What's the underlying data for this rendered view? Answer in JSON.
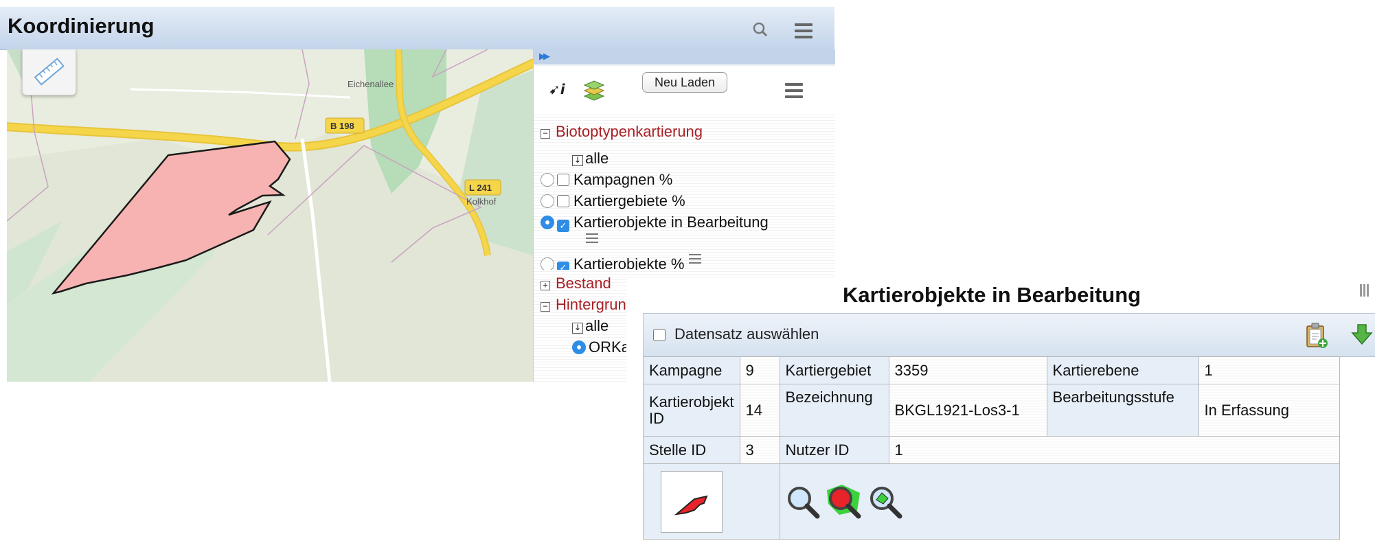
{
  "window": {
    "title": "Koordinierung"
  },
  "map": {
    "labels": {
      "street": "Eichenallee",
      "road_b": "B 198",
      "road_l": "L 241",
      "place": "Kolkhof"
    }
  },
  "panel": {
    "reload_label": "Neu Laden",
    "groups": [
      {
        "label": "Biotoptypenkartierung",
        "expanded": true,
        "all_label": "alle",
        "layers": [
          {
            "label": "Kampagnen %",
            "radio": false,
            "checked": false
          },
          {
            "label": "Kartiergebiete %",
            "radio": false,
            "checked": false
          },
          {
            "label": "Kartierobjekte in Bearbeitung",
            "radio": true,
            "checked": true
          },
          {
            "label": "Kartierobjekte %",
            "radio": false,
            "checked": true
          }
        ]
      },
      {
        "label": "Bestand",
        "expanded": false
      },
      {
        "label": "Hintergrund",
        "expanded": true,
        "all_label": "alle",
        "layers": [
          {
            "label": "ORKa",
            "radio": true
          }
        ]
      }
    ]
  },
  "popup": {
    "title": "Kartierobjekte in Bearbeitung",
    "select_label": "Datensatz auswählen",
    "fields": {
      "kampagne": {
        "label": "Kampagne",
        "value": "9"
      },
      "kartiergebiet": {
        "label": "Kartiergebiet",
        "value": "3359"
      },
      "kartierebene": {
        "label": "Kartierebene",
        "value": "1"
      },
      "kartierobjekt_id": {
        "label": "Kartierobjekt ID",
        "value": "14"
      },
      "bezeichnung": {
        "label": "Bezeichnung",
        "value": "BKGL1921-Los3-1"
      },
      "bearbeitungsstufe": {
        "label": "Bearbeitungsstufe",
        "value": "In Erfassung"
      },
      "stelle_id": {
        "label": "Stelle ID",
        "value": "3"
      },
      "nutzer_id": {
        "label": "Nutzer ID",
        "value": "1"
      }
    }
  },
  "colors": {
    "polygon": "#f7b3b1",
    "road_yellow": "#f5d54a",
    "group_red": "#a81f24",
    "accent_blue": "#2e8de6"
  }
}
